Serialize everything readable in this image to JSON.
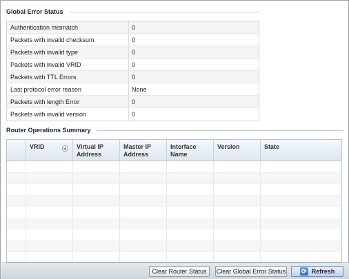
{
  "global_error_status": {
    "title": "Global Error Status",
    "rows": [
      {
        "label": "Authentication mismatch",
        "value": "0"
      },
      {
        "label": "Packets with invalid checksum",
        "value": "0"
      },
      {
        "label": "Packets with invalid type",
        "value": "0"
      },
      {
        "label": "Packets with invalid VRID",
        "value": "0"
      },
      {
        "label": "Packets with TTL Errors",
        "value": "0"
      },
      {
        "label": "Last protocol error reason",
        "value": "None"
      },
      {
        "label": "Packets with length Error",
        "value": "0"
      },
      {
        "label": "Packets with invalid version",
        "value": "0"
      }
    ]
  },
  "router_operations_summary": {
    "title": "Router Operations Summary",
    "columns": [
      {
        "line1": "VRID",
        "line2": ""
      },
      {
        "line1": "Virtual IP",
        "line2": "Address"
      },
      {
        "line1": "Master IP",
        "line2": "Address"
      },
      {
        "line1": "Interface",
        "line2": "Name"
      },
      {
        "line1": "Version",
        "line2": ""
      },
      {
        "line1": "State",
        "line2": ""
      }
    ],
    "empty_rows": 9
  },
  "footer": {
    "clear_router_label": "Clear Router Status",
    "clear_global_label": "Clear Global Error Status",
    "refresh_label": "Refresh",
    "refresh_icon": "refresh-icon",
    "sort_icon": "sort-icon"
  },
  "colors": {
    "header_gradient_top": "#f3f7fa",
    "header_gradient_bottom": "#dfe8ef",
    "refresh_accent": "#2f6db6"
  }
}
